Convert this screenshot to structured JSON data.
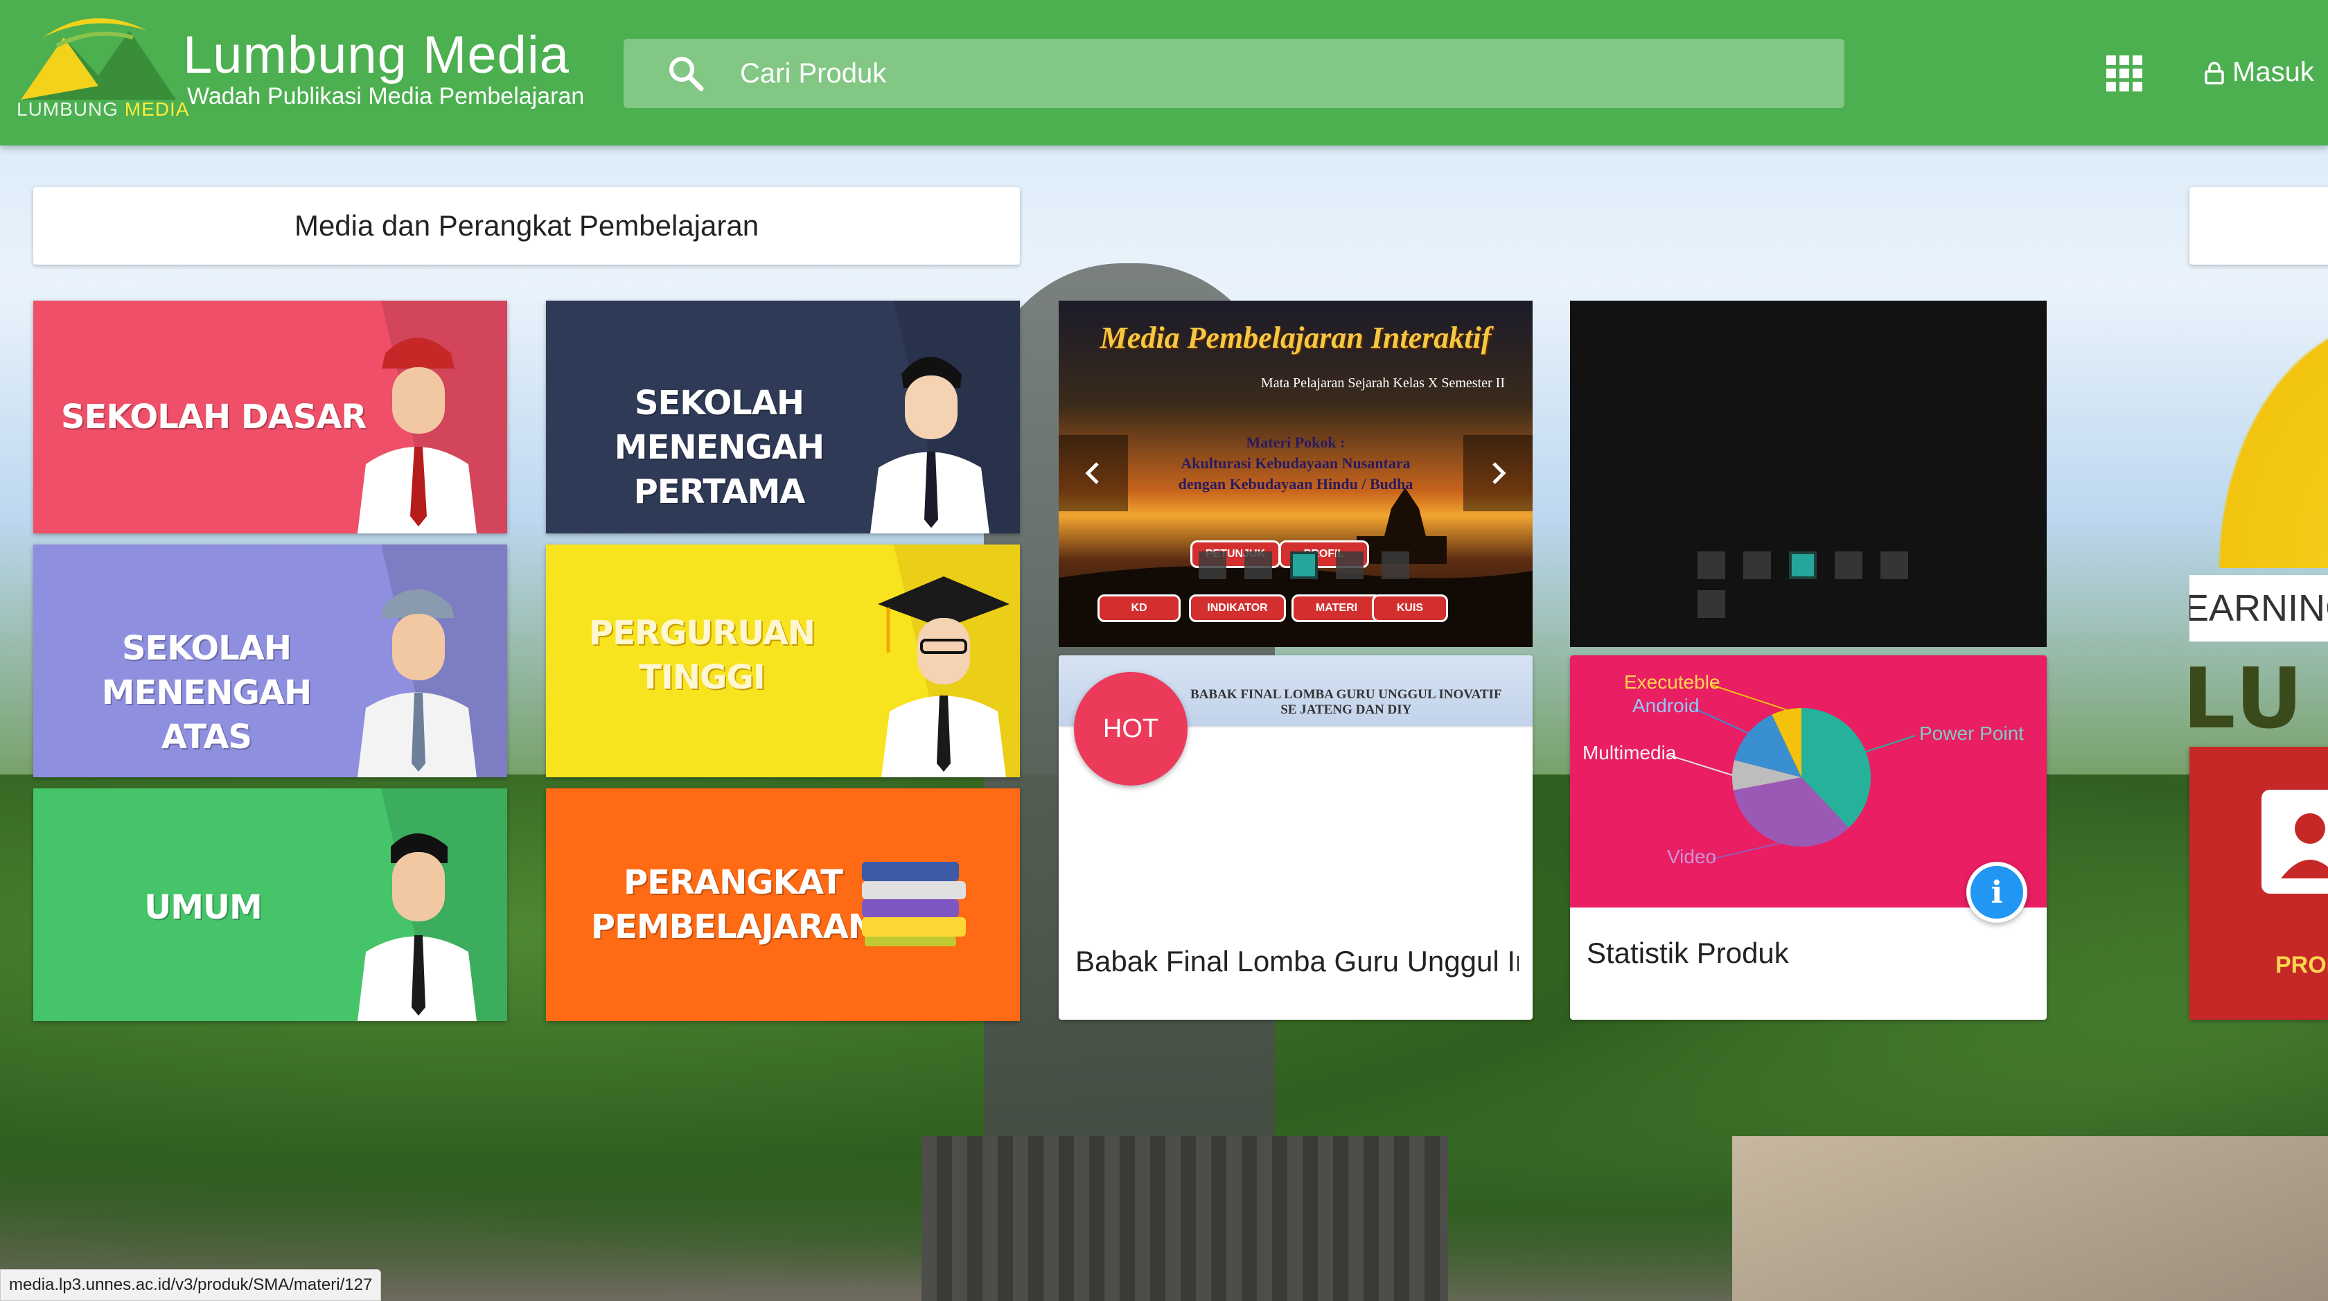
{
  "header": {
    "logo_caption_a": "LUMBUNG",
    "logo_caption_b": "MEDIA",
    "brand_title": "Lumbung Media",
    "brand_subtitle": "Wadah Publikasi Media Pembelajaran",
    "search_placeholder": "Cari Produk",
    "login_label": "Masuk"
  },
  "section_title": "Media dan Perangkat Pembelajaran",
  "categories": [
    {
      "label_1": "SEKOLAH DASAR",
      "label_2": "",
      "color": "#ef4f68"
    },
    {
      "label_1": "SEKOLAH MENENGAH",
      "label_2": "PERTAMA",
      "color": "#2f3a56"
    },
    {
      "label_1": "SEKOLAH MENENGAH",
      "label_2": "ATAS",
      "color": "#8f8fe0"
    },
    {
      "label_1": "PERGURUAN",
      "label_2": "TINGGI",
      "color": "#f7e41f"
    },
    {
      "label_1": "UMUM",
      "label_2": "",
      "color": "#45c46a"
    },
    {
      "label_1": "PERANGKAT",
      "label_2": "PEMBELAJARAN",
      "color": "#ff6a14"
    }
  ],
  "slider": {
    "title": "Media Pembelajaran Interaktif",
    "subtitle": "Mata Pelajaran Sejarah Kelas X Semester II",
    "materi_1": "Materi Pokok :",
    "materi_2": "Akulturasi Kebudayaan Nusantara",
    "materi_3": "dengan Kebudayaan Hindu / Budha",
    "buttons": [
      "PETUNJUK",
      "PROFIL",
      "KD",
      "INDIKATOR",
      "MATERI",
      "KUIS"
    ]
  },
  "news_card": {
    "badge": "HOT",
    "banner_text_1": "BABAK FINAL LOMBA GURU UNGGUL INOVATIF",
    "banner_text_2": "SE JATENG DAN DIY",
    "title": "Babak Final Lomba Guru Unggul Inovati"
  },
  "stats_card": {
    "title": "Statistik Produk",
    "chart_data": {
      "type": "pie",
      "slices": [
        {
          "label": "Power Point",
          "value": 38,
          "color": "#26b29a"
        },
        {
          "label": "Video",
          "value": 34,
          "color": "#9b59b6"
        },
        {
          "label": "Multimedia",
          "value": 7,
          "color": "#bdbdbd"
        },
        {
          "label": "Android",
          "value": 14,
          "color": "#3a8fd0"
        },
        {
          "label": "Executeble",
          "value": 7,
          "color": "#f4c20d"
        }
      ]
    }
  },
  "edge": {
    "learning_text": "EARNING",
    "lu_text": "LU",
    "red_label": "PROF"
  },
  "status_url": "media.lp3.unnes.ac.id/v3/produk/SMA/materi/127"
}
